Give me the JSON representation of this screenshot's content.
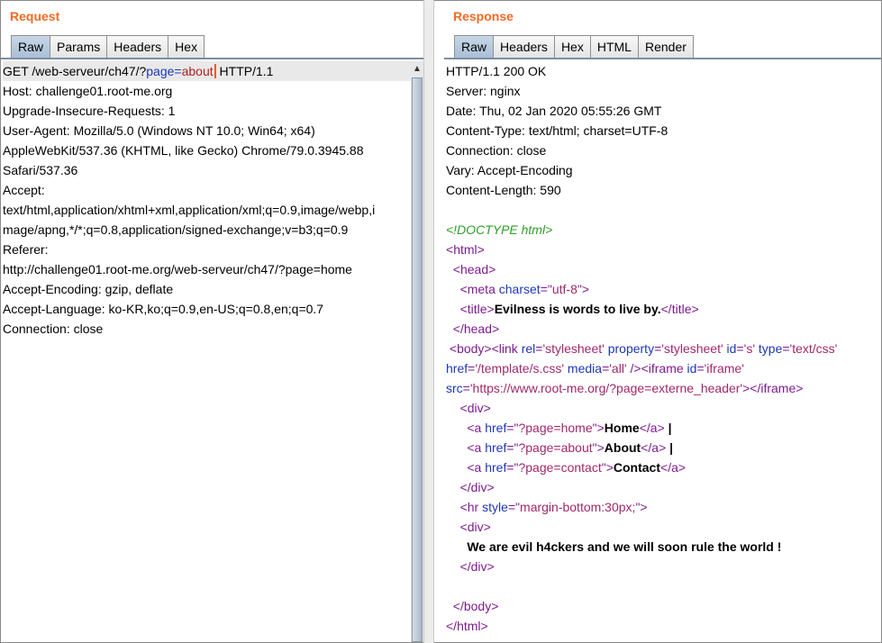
{
  "request": {
    "title": "Request",
    "tabs": [
      "Raw",
      "Params",
      "Headers",
      "Hex"
    ],
    "first_line": {
      "prefix": "GET /web-serveur/ch47/?",
      "param_name": "page",
      "equals": "=",
      "param_value": "about",
      "suffix": " HTTP/1.1"
    },
    "lines": [
      "Host: challenge01.root-me.org",
      "Upgrade-Insecure-Requests: 1",
      "User-Agent: Mozilla/5.0 (Windows NT 10.0; Win64; x64)",
      "AppleWebKit/537.36 (KHTML, like Gecko) Chrome/79.0.3945.88",
      "Safari/537.36",
      "Accept:",
      "text/html,application/xhtml+xml,application/xml;q=0.9,image/webp,i",
      "mage/apng,*/*;q=0.8,application/signed-exchange;v=b3;q=0.9",
      "Referer:",
      "http://challenge01.root-me.org/web-serveur/ch47/?page=home",
      "Accept-Encoding: gzip, deflate",
      "Accept-Language: ko-KR,ko;q=0.9,en-US;q=0.8,en;q=0.7",
      "Connection: close"
    ]
  },
  "response": {
    "title": "Response",
    "tabs": [
      "Raw",
      "Headers",
      "Hex",
      "HTML",
      "Render"
    ],
    "headers": [
      "HTTP/1.1 200 OK",
      "Server: nginx",
      "Date: Thu, 02 Jan 2020 05:55:26 GMT",
      "Content-Type: text/html; charset=UTF-8",
      "Connection: close",
      "Vary: Accept-Encoding",
      "Content-Length: 590"
    ],
    "body": [
      [
        {
          "t": "<!DOCTYPE html>",
          "c": "cmt"
        }
      ],
      [
        {
          "t": "<",
          "c": "tag"
        },
        {
          "t": "html",
          "c": "tag"
        },
        {
          "t": ">",
          "c": "tag"
        }
      ],
      [
        {
          "t": "  "
        },
        {
          "t": "<head>",
          "c": "tag"
        }
      ],
      [
        {
          "t": "    "
        },
        {
          "t": "<meta ",
          "c": "tag"
        },
        {
          "t": "charset",
          "c": "attr"
        },
        {
          "t": "=\"",
          "c": "tag"
        },
        {
          "t": "utf-8",
          "c": "val"
        },
        {
          "t": "\">",
          "c": "tag"
        }
      ],
      [
        {
          "t": "    "
        },
        {
          "t": "<title>",
          "c": "tag"
        },
        {
          "t": "Evilness is words to live by.",
          "c": "txt"
        },
        {
          "t": "</title>",
          "c": "tag"
        }
      ],
      [
        {
          "t": "  "
        },
        {
          "t": "</head>",
          "c": "tag"
        }
      ],
      [
        {
          "t": " "
        },
        {
          "t": "<body><link ",
          "c": "tag"
        },
        {
          "t": "rel",
          "c": "attr"
        },
        {
          "t": "=",
          "c": "tag"
        },
        {
          "t": "'stylesheet'",
          "c": "val"
        },
        {
          "t": " property",
          "c": "attr"
        },
        {
          "t": "=",
          "c": "tag"
        },
        {
          "t": "'stylesheet'",
          "c": "val"
        },
        {
          "t": " id",
          "c": "attr"
        },
        {
          "t": "=",
          "c": "tag"
        },
        {
          "t": "'s'",
          "c": "val"
        },
        {
          "t": " type",
          "c": "attr"
        },
        {
          "t": "=",
          "c": "tag"
        },
        {
          "t": "'text/css'",
          "c": "val"
        }
      ],
      [
        {
          "t": "href",
          "c": "attr"
        },
        {
          "t": "=",
          "c": "tag"
        },
        {
          "t": "'/template/s.css'",
          "c": "val"
        },
        {
          "t": " media",
          "c": "attr"
        },
        {
          "t": "=",
          "c": "tag"
        },
        {
          "t": "'all'",
          "c": "val"
        },
        {
          "t": " /><iframe ",
          "c": "tag"
        },
        {
          "t": "id",
          "c": "attr"
        },
        {
          "t": "=",
          "c": "tag"
        },
        {
          "t": "'iframe'",
          "c": "val"
        }
      ],
      [
        {
          "t": "src",
          "c": "attr"
        },
        {
          "t": "=",
          "c": "tag"
        },
        {
          "t": "'https://www.root-me.org/?page=externe_header'",
          "c": "val"
        },
        {
          "t": "></iframe>",
          "c": "tag"
        }
      ],
      [
        {
          "t": "    "
        },
        {
          "t": "<div>",
          "c": "tag"
        }
      ],
      [
        {
          "t": "      "
        },
        {
          "t": "<a ",
          "c": "tag"
        },
        {
          "t": "href",
          "c": "attr"
        },
        {
          "t": "=\"",
          "c": "tag"
        },
        {
          "t": "?page=home",
          "c": "val"
        },
        {
          "t": "\">",
          "c": "tag"
        },
        {
          "t": "Home",
          "c": "txt"
        },
        {
          "t": "</a>",
          "c": "tag"
        },
        {
          "t": " |",
          "c": "txt"
        }
      ],
      [
        {
          "t": "      "
        },
        {
          "t": "<a ",
          "c": "tag"
        },
        {
          "t": "href",
          "c": "attr"
        },
        {
          "t": "=\"",
          "c": "tag"
        },
        {
          "t": "?page=about",
          "c": "val"
        },
        {
          "t": "\">",
          "c": "tag"
        },
        {
          "t": "About",
          "c": "txt"
        },
        {
          "t": "</a>",
          "c": "tag"
        },
        {
          "t": " |",
          "c": "txt"
        }
      ],
      [
        {
          "t": "      "
        },
        {
          "t": "<a ",
          "c": "tag"
        },
        {
          "t": "href",
          "c": "attr"
        },
        {
          "t": "=\"",
          "c": "tag"
        },
        {
          "t": "?page=contact",
          "c": "val"
        },
        {
          "t": "\">",
          "c": "tag"
        },
        {
          "t": "Contact",
          "c": "txt"
        },
        {
          "t": "</a>",
          "c": "tag"
        }
      ],
      [
        {
          "t": "    "
        },
        {
          "t": "</div>",
          "c": "tag"
        }
      ],
      [
        {
          "t": "    "
        },
        {
          "t": "<hr ",
          "c": "tag"
        },
        {
          "t": "style",
          "c": "attr"
        },
        {
          "t": "=\"",
          "c": "tag"
        },
        {
          "t": "margin-bottom:30px;",
          "c": "val"
        },
        {
          "t": "\">",
          "c": "tag"
        }
      ],
      [
        {
          "t": "    "
        },
        {
          "t": "<div>",
          "c": "tag"
        }
      ],
      [
        {
          "t": "      "
        },
        {
          "t": "We are evil h4ckers and we will soon rule the world !",
          "c": "txt"
        }
      ],
      [
        {
          "t": "    "
        },
        {
          "t": "</div>",
          "c": "tag"
        }
      ],
      [
        {
          "t": ""
        }
      ],
      [
        {
          "t": "  "
        },
        {
          "t": "</body>",
          "c": "tag"
        }
      ],
      [
        {
          "t": "</html>",
          "c": "tag"
        }
      ]
    ]
  },
  "colors": {
    "title": "#f26a24",
    "tag": "#7d1b8f",
    "attribute": "#1d36b8",
    "value": "#a0286b",
    "comment": "#2e9e2a",
    "active_tab": "#a9bfd6"
  },
  "icons": {
    "scroll_up": "triangle-up-icon"
  }
}
